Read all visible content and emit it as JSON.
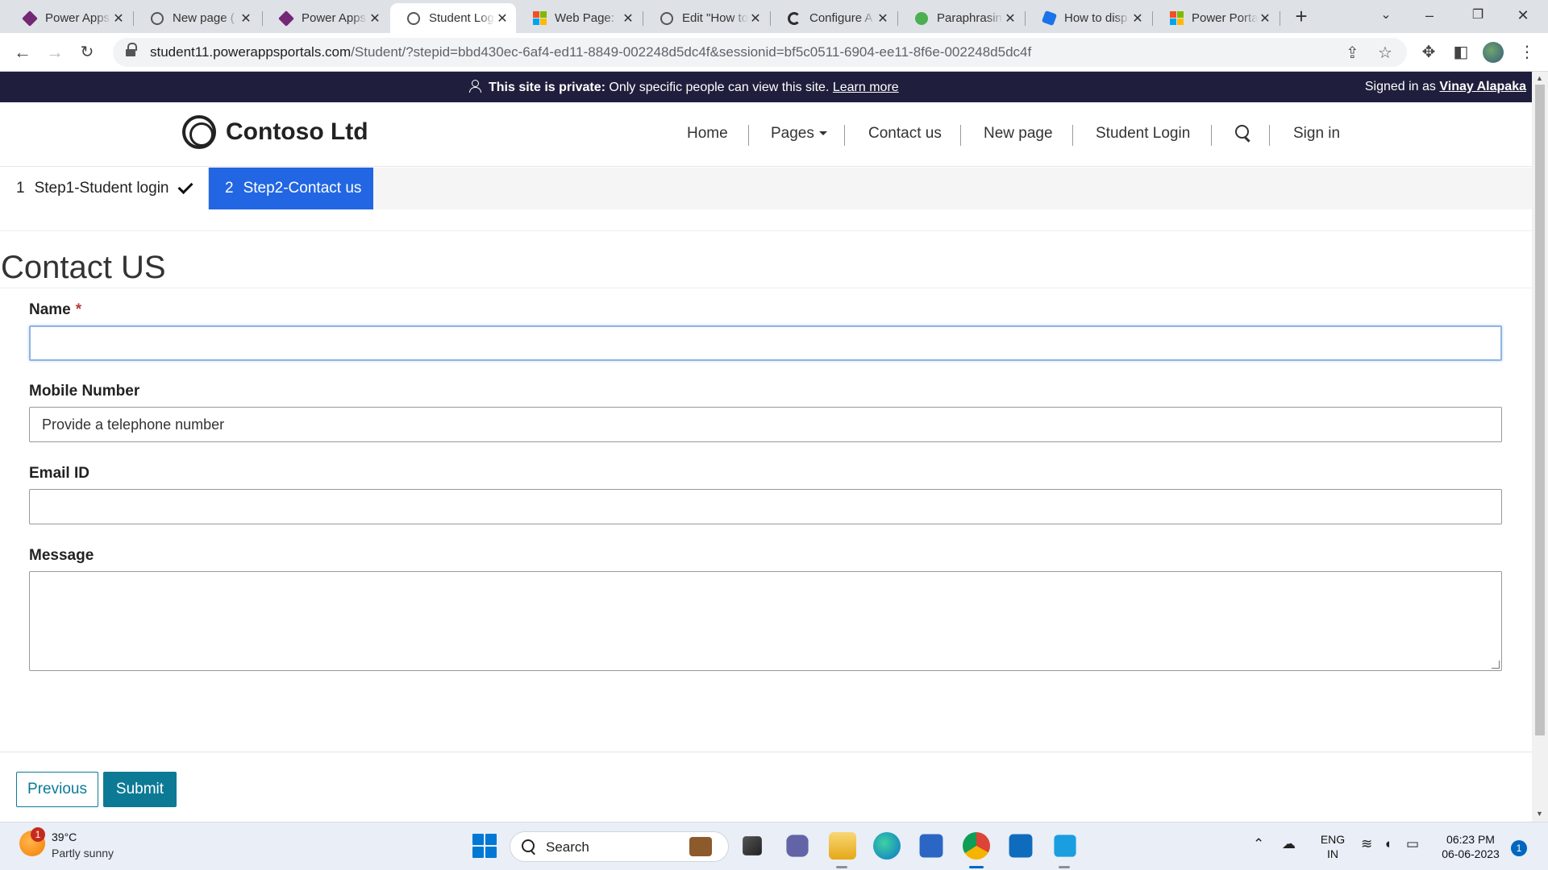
{
  "browser": {
    "tabs": [
      {
        "title": "Power Apps",
        "icon": "power-apps-icon"
      },
      {
        "title": "New page (",
        "icon": "globe-icon"
      },
      {
        "title": "Power Apps",
        "icon": "power-apps-icon"
      },
      {
        "title": "Student Log",
        "icon": "globe-icon",
        "active": true
      },
      {
        "title": "Web Page: ",
        "icon": "microsoft-icon"
      },
      {
        "title": "Edit \"How to",
        "icon": "globe-icon"
      },
      {
        "title": "Configure A",
        "icon": "c-logo-icon"
      },
      {
        "title": "Paraphrasin",
        "icon": "quillbot-icon"
      },
      {
        "title": "How to disp",
        "icon": "power-pages-icon"
      },
      {
        "title": "Power Porta",
        "icon": "microsoft-icon"
      }
    ],
    "url_host": "student11.powerappsportals.com",
    "url_path": "/Student/?stepid=bbd430ec-6af4-ed11-8849-002248d5dc4f&sessionid=bf5c0511-6904-ee11-8f6e-002248d5dc4f"
  },
  "banner": {
    "private_label": "This site is private:",
    "private_text": " Only specific people can view this site.",
    "learn_more": "Learn more",
    "signed_in_prefix": "Signed in as ",
    "signed_in_user": "Vinay Alapaka"
  },
  "site": {
    "brand": "Contoso Ltd",
    "nav": {
      "home": "Home",
      "pages": "Pages",
      "contact": "Contact us",
      "new_page": "New page",
      "student_login": "Student Login",
      "sign_in": "Sign in"
    }
  },
  "steps": {
    "step1_num": "1",
    "step1_label": "Step1-Student login",
    "step2_num": "2",
    "step2_label": "Step2-Contact us"
  },
  "form": {
    "title": "Contact US",
    "name_label": "Name",
    "name_required": "*",
    "name_value": "",
    "mobile_label": "Mobile Number",
    "mobile_placeholder": "Provide a telephone number",
    "email_label": "Email ID",
    "email_value": "",
    "message_label": "Message",
    "message_value": "",
    "previous": "Previous",
    "submit": "Submit"
  },
  "taskbar": {
    "weather_badge": "1",
    "temperature": "39°C",
    "weather": "Partly sunny",
    "search": "Search",
    "lang_1": "ENG",
    "lang_2": "IN",
    "time": "06:23 PM",
    "date": "06-06-2023",
    "notifications": "1"
  },
  "colors": {
    "banner_bg": "#1f1f3d",
    "step_active": "#2266e3",
    "primary_button": "#0c7a95"
  }
}
